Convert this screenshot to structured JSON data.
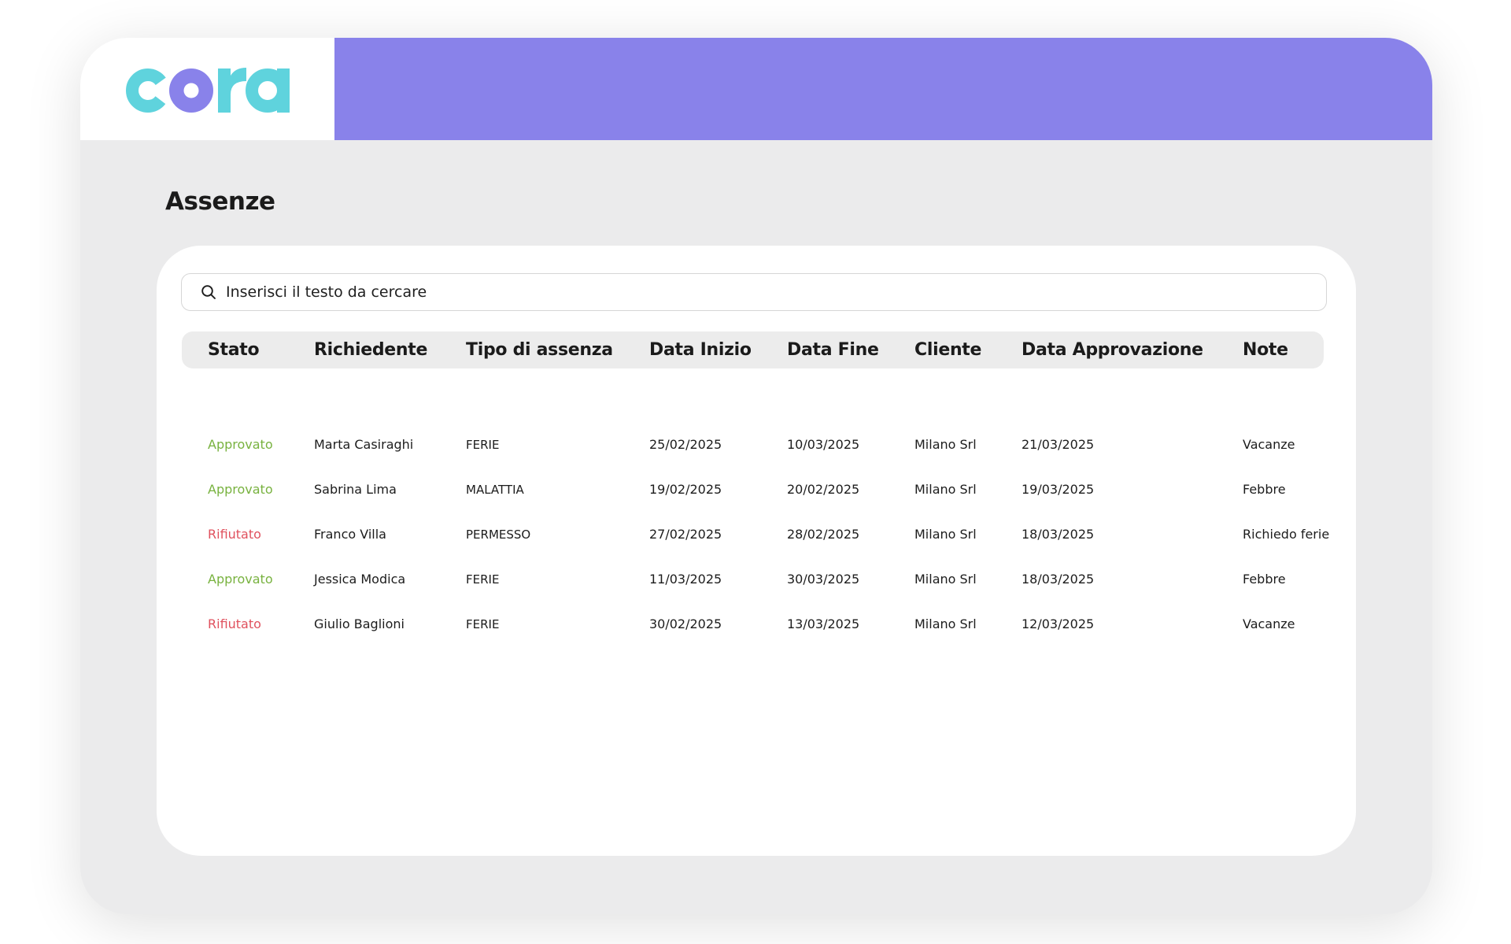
{
  "brand": {
    "name": "cora",
    "colors": {
      "teal": "#5fd3dd",
      "purple": "#8982ea",
      "band": "#8982ea"
    }
  },
  "page": {
    "title": "Assenze"
  },
  "search": {
    "placeholder": "Inserisci il testo da cercare",
    "value": "",
    "icon": "search-icon"
  },
  "table": {
    "columns": [
      "Stato",
      "Richiedente",
      "Tipo di assenza",
      "Data Inizio",
      "Data Fine",
      "Cliente",
      "Data Approvazione",
      "Note"
    ],
    "rows": [
      {
        "status": "Approvato",
        "status_kind": "approved",
        "requester": "Marta Casiraghi",
        "type": "FERIE",
        "start": "25/02/2025",
        "end": "10/03/2025",
        "client": "Milano Srl",
        "approval": "21/03/2025",
        "note": "Vacanze"
      },
      {
        "status": "Approvato",
        "status_kind": "approved",
        "requester": "Sabrina Lima",
        "type": "MALATTIA",
        "start": "19/02/2025",
        "end": "20/02/2025",
        "client": "Milano Srl",
        "approval": "19/03/2025",
        "note": "Febbre"
      },
      {
        "status": "Rifiutato",
        "status_kind": "rejected",
        "requester": "Franco Villa",
        "type": "PERMESSO",
        "start": "27/02/2025",
        "end": "28/02/2025",
        "client": "Milano Srl",
        "approval": "18/03/2025",
        "note": "Richiedo ferie"
      },
      {
        "status": "Approvato",
        "status_kind": "approved",
        "requester": "Jessica Modica",
        "type": "FERIE",
        "start": "11/03/2025",
        "end": "30/03/2025",
        "client": "Milano Srl",
        "approval": "18/03/2025",
        "note": "Febbre"
      },
      {
        "status": "Rifiutato",
        "status_kind": "rejected",
        "requester": "Giulio Baglioni",
        "type": "FERIE",
        "start": "30/02/2025",
        "end": "13/03/2025",
        "client": "Milano Srl",
        "approval": "12/03/2025",
        "note": "Vacanze"
      }
    ]
  },
  "status_colors": {
    "approved": "#78b23f",
    "rejected": "#e0515e"
  }
}
